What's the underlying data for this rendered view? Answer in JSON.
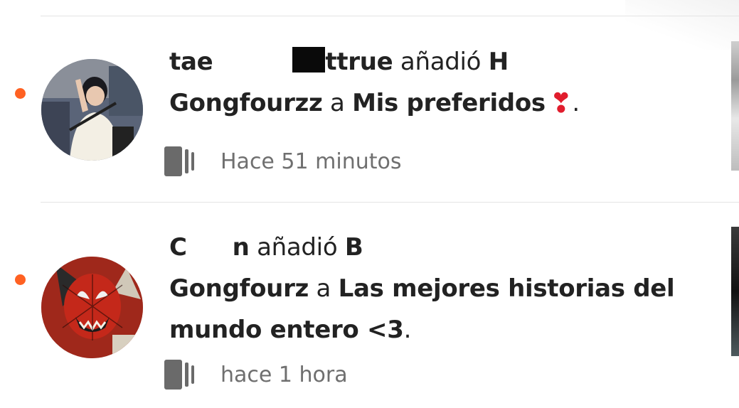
{
  "notifications": [
    {
      "user_visible_start": "tae",
      "user_visible_end": "ttrue",
      "verb": "añadió",
      "story_visible": "H",
      "author": "Gongfourzz",
      "connector": "a",
      "list_name": "Mis preferidos",
      "emoji": "❣",
      "trailing": ".",
      "time": "Hace 51 minutos",
      "unread": true,
      "icon": "reading-list-icon"
    },
    {
      "user_visible_start": "C",
      "user_visible_end": "n",
      "verb": "añadió",
      "story_visible": "B",
      "author": "Gongfourz",
      "connector": "a",
      "list_name_line1": "Las mejores historias del",
      "list_name_line2": "mundo entero <3",
      "trailing": ".",
      "time": "hace 1 hora",
      "unread": true,
      "icon": "reading-list-icon"
    }
  ],
  "colors": {
    "unread_dot": "#ff6122",
    "text": "#222222",
    "meta_text": "#6f6f6f",
    "divider": "#e4e4e4"
  }
}
